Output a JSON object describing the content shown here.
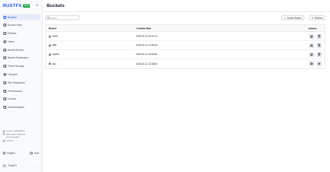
{
  "app": {
    "brand": "RUSTFS",
    "badge": "beta"
  },
  "sidebar": {
    "items": [
      {
        "label": "Browser",
        "icon": "browser-icon",
        "active": true
      },
      {
        "label": "Access Keys",
        "icon": "key-icon",
        "active": false
      },
      {
        "label": "Policies",
        "icon": "policy-icon",
        "active": false
      },
      {
        "label": "Users",
        "icon": "user-icon",
        "active": false
      },
      {
        "label": "Bucket Events",
        "icon": "bell-icon",
        "active": false
      },
      {
        "label": "Bucket Replication",
        "icon": "replication-icon",
        "active": false
      },
      {
        "label": "Tiered Storage",
        "icon": "layers-icon",
        "active": false
      },
      {
        "label": "Lifecycle",
        "icon": "lifecycle-icon",
        "active": false
      },
      {
        "label": "Site Replication",
        "icon": "site-icon",
        "active": false
      },
      {
        "label": "Performance",
        "icon": "chart-icon",
        "active": false
      },
      {
        "label": "License",
        "icon": "license-icon",
        "active": false
      },
      {
        "label": "Documentation",
        "icon": "doc-icon",
        "active": false
      }
    ],
    "version_line": "Version: @8d6f5f73",
    "build_line": "Build Date: 2025-05-",
    "build_line2": "27T14:44:28Z",
    "license_line": "License",
    "language": "English",
    "theme": "Auto",
    "user_initials": "RF",
    "user_name": "RustFS",
    "user_more": "⋮"
  },
  "main": {
    "title": "Buckets",
    "search_placeholder": "Search",
    "create_label": "Create Bucket",
    "refresh_label": "Refresh",
    "columns": {
      "bucket": "Bucket",
      "date": "Creation Date",
      "actions": "Actions"
    },
    "rows": [
      {
        "name": "dosle",
        "date": "2025-04-14 09:44:13"
      },
      {
        "name": "fffffe",
        "date": "2025-04-13 13:35:16"
      },
      {
        "name": "mytest",
        "date": "2025-04-13 16:53:52"
      },
      {
        "name": "test",
        "date": "2025-04-12 13:38:09"
      }
    ]
  }
}
